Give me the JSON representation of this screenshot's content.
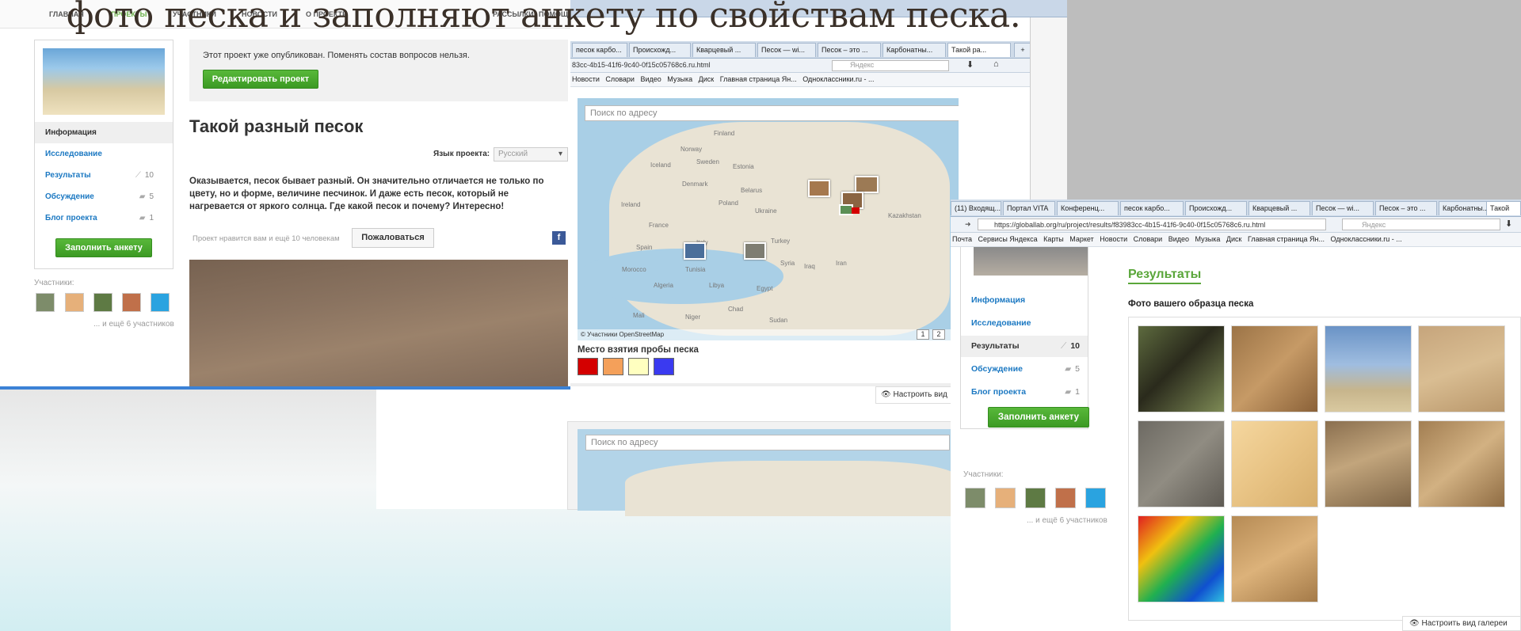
{
  "slide_title": "фото песка и заполняют анкету по свойствам песка.",
  "window1": {
    "topnav": [
      "ГЛАВНАЯ",
      "ПРОЕКТЫ",
      "УЧАСТНИКИ",
      "НОВОСТИ",
      "О ПРОЕКТЕ",
      "РАССЫЛКИ",
      "ПОМОЩЬ"
    ],
    "notice": "Этот проект уже опубликован. Поменять состав вопросов нельзя.",
    "edit_button": "Редактировать проект",
    "title": "Такой разный песок",
    "lang_label": "Язык проекта:",
    "lang_value": "Русский",
    "description": "Оказывается, песок бывает разный. Он значительно отличается не только по цвету, но и форме, величине песчинок. И даже есть песок, который не нагревается от яркого солнца. Где какой песок и почему? Интересно!",
    "likes": "Проект нравится вам и ещё 10 человекам",
    "complain_button": "Пожаловаться",
    "fb": "f",
    "sidebar": [
      {
        "label": "Информация",
        "count": ""
      },
      {
        "label": "Исследование",
        "count": ""
      },
      {
        "label": "Результаты",
        "count": "10"
      },
      {
        "label": "Обсуждение",
        "count": "5"
      },
      {
        "label": "Блог проекта",
        "count": "1"
      }
    ],
    "fill_button": "Заполнить анкету",
    "participants_label": "Участники:",
    "more_participants": "... и ещё 6 участников"
  },
  "window2": {
    "tabs": [
      "песок карбо...",
      "Происхожд...",
      "Кварцевый ...",
      "Песок — wi...",
      "Песок – это ...",
      "Карбонатны...",
      "Такой ра..."
    ],
    "url": "83cc-4b15-41f6-9c40-0f15c05768c6.ru.html",
    "search_engine": "Яндекс",
    "bookmarks": [
      "Новости",
      "Словари",
      "Видео",
      "Музыка",
      "Диск",
      "Главная страница Ян...",
      "Одноклассники.ru - ..."
    ],
    "map_search": "Поиск по адресу",
    "attribution": "© Участники OpenStreetMap",
    "pages": [
      "1",
      "2"
    ],
    "legend_title": "Место взятия пробы песка",
    "swatches": [
      "#d40000",
      "#f4a05a",
      "#ffffc0",
      "#3a3af0"
    ],
    "settings_button": "Настроить вид",
    "map_search_2": "Поиск по адресу",
    "map_labels": [
      "Finland",
      "Norway",
      "Sweden",
      "Estonia",
      "Iceland",
      "Ireland",
      "Denmark",
      "Poland",
      "Belarus",
      "Ukraine",
      "France",
      "Spain",
      "Italy",
      "Turkey",
      "Syria",
      "Iraq",
      "Iran",
      "Egypt",
      "Libya",
      "Algeria",
      "Tunisia",
      "Morocco",
      "Kazakhstan",
      "Sudan",
      "Mali",
      "Niger",
      "Chad"
    ]
  },
  "window3": {
    "tabs": [
      "(11) Входящ...",
      "Портал VITA",
      "Конференц...",
      "песок карбо...",
      "Происхожд...",
      "Кварцевый ...",
      "Песок — wi...",
      "Песок – это ...",
      "Карбонатны...",
      "Такой"
    ],
    "url": "https://globallab.org/ru/project/results/f83983cc-4b15-41f6-9c40-0f15c05768c6.ru.html",
    "search_engine": "Яндекс",
    "bookmarks": [
      "Почта",
      "Сервисы Яндекса",
      "Карты",
      "Маркет",
      "Новости",
      "Словари",
      "Видео",
      "Музыка",
      "Диск",
      "Главная страница Ян...",
      "Одноклассники.ru - ..."
    ],
    "sidebar": [
      {
        "label": "Информация",
        "count": ""
      },
      {
        "label": "Исследование",
        "count": ""
      },
      {
        "label": "Результаты",
        "count": "10"
      },
      {
        "label": "Обсуждение",
        "count": "5"
      },
      {
        "label": "Блог проекта",
        "count": "1"
      }
    ],
    "fill_button": "Заполнить анкету",
    "participants_label": "Участники:",
    "more_participants": "... и ещё 6 участников",
    "results_title": "Результаты",
    "gallery_title": "Фото вашего образца песка",
    "settings_button": "Настроить вид галереи",
    "thumbs": [
      "linear-gradient(135deg,#5d6a3e,#2a2a1c 45%,#7d8a55)",
      "linear-gradient(135deg,#9c7447,#c69a66 50%,#8a6138)",
      "linear-gradient(#6a93c6,#9fbde0 45%,#c7b58c 75%,#d9c9a0)",
      "linear-gradient(160deg,#c6a57c,#d9bd92 50%,#b9976b)",
      "linear-gradient(135deg,#6d6a63,#908c82 50%,#5e5a53)",
      "linear-gradient(135deg,#f5d79f,#e8c384 50%,#d7ae6c)",
      "linear-gradient(160deg,#8a6f4f,#c2a57c 45%,#7d6446)",
      "linear-gradient(140deg,#a27e52,#d2b182 50%,#8f6c43)",
      "linear-gradient(135deg,#e02020 0%,#f0c010 30%,#20b050 55%,#1050d0 80%,#30c0e0)",
      "linear-gradient(150deg,#b68b55,#dcb27a 50%,#a47a48)"
    ]
  }
}
